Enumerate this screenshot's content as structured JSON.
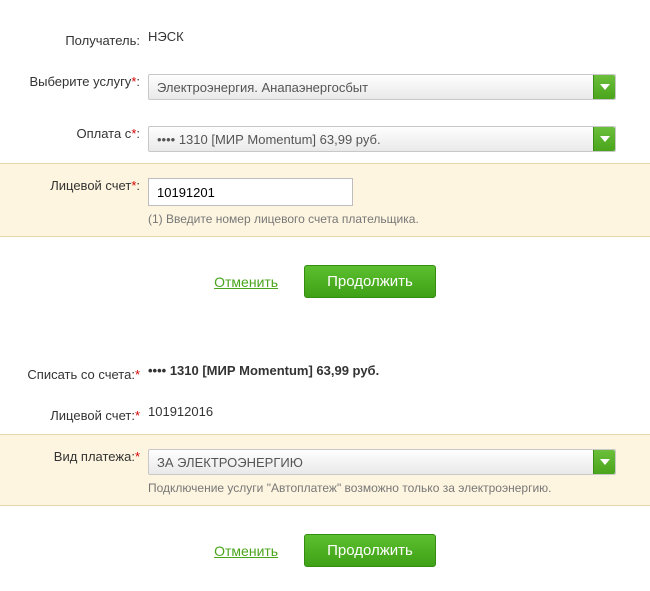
{
  "form1": {
    "recipient": {
      "label": "Получатель:",
      "value": "НЭСК"
    },
    "service": {
      "label": "Выберите услугу*:",
      "selected": "Электроэнергия. Анапаэнергосбыт"
    },
    "payFrom": {
      "label": "Оплата с*:",
      "selected": "•••• 1310 [МИР Momentum] 63,99 руб."
    },
    "account": {
      "label": "Лицевой счет*:",
      "value": "10191201",
      "hint": "(1) Введите номер лицевого счета плательщика."
    },
    "actions": {
      "cancel": "Отменить",
      "continue": "Продолжить"
    }
  },
  "form2": {
    "writeOff": {
      "label": "Списать со счета:*",
      "value": "•••• 1310  [МИР Momentum] 63,99   руб."
    },
    "account": {
      "label": "Лицевой счет:*",
      "value": "101912016"
    },
    "paymentType": {
      "label": "Вид платежа:*",
      "selected": "ЗА ЭЛЕКТРОЭНЕРГИЮ",
      "hint": "Подключение услуги \"Автоплатеж\" возможно только за электроэнергию."
    },
    "actions": {
      "cancel": "Отменить",
      "continue": "Продолжить"
    }
  }
}
